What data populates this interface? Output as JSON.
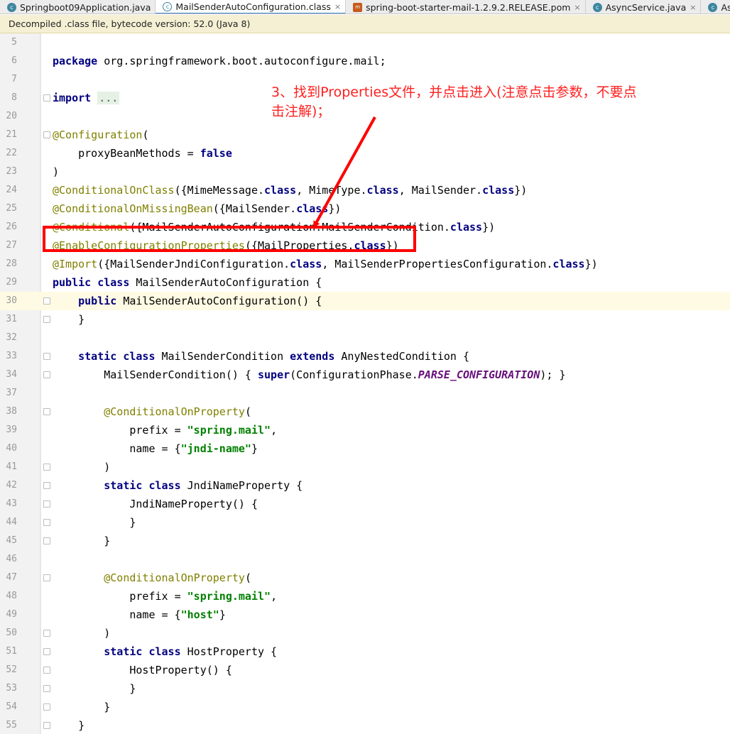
{
  "tabs": [
    {
      "label": "Springboot09Application.java",
      "icon": "java-class-icon",
      "active": false,
      "closable": false
    },
    {
      "label": "MailSenderAutoConfiguration.class",
      "icon": "class-file-icon",
      "active": true,
      "closable": true
    },
    {
      "label": "spring-boot-starter-mail-1.2.9.2.RELEASE.pom",
      "icon": "pom-file-icon",
      "active": false,
      "closable": true
    },
    {
      "label": "AsyncService.java",
      "icon": "java-class-icon",
      "active": false,
      "closable": true
    },
    {
      "label": "AsyncCom",
      "icon": "java-class-icon",
      "active": false,
      "closable": false
    }
  ],
  "banner": {
    "text": "Decompiled .class file, bytecode version: 52.0 (Java 8)"
  },
  "editor": {
    "lines": [
      {
        "num": "5",
        "code": ""
      },
      {
        "num": "6",
        "code": "package org.springframework.boot.autoconfigure.mail;"
      },
      {
        "num": "7",
        "code": ""
      },
      {
        "num": "8",
        "code": "import ...",
        "fold": true
      },
      {
        "num": "20",
        "code": ""
      },
      {
        "num": "21",
        "code": "@Configuration(",
        "fold": true
      },
      {
        "num": "22",
        "code": "    proxyBeanMethods = false"
      },
      {
        "num": "23",
        "code": ")"
      },
      {
        "num": "24",
        "code": "@ConditionalOnClass({MimeMessage.class, MimeType.class, MailSender.class})"
      },
      {
        "num": "25",
        "code": "@ConditionalOnMissingBean({MailSender.class})"
      },
      {
        "num": "26",
        "code": "@Conditional({MailSenderAutoConfiguration.MailSenderCondition.class})"
      },
      {
        "num": "27",
        "code": "@EnableConfigurationProperties({MailProperties.class})"
      },
      {
        "num": "28",
        "code": "@Import({MailSenderJndiConfiguration.class, MailSenderPropertiesConfiguration.class})"
      },
      {
        "num": "29",
        "code": "public class MailSenderAutoConfiguration {"
      },
      {
        "num": "30",
        "code": "    public MailSenderAutoConfiguration() {",
        "fold": true,
        "current": true
      },
      {
        "num": "31",
        "code": "    }",
        "fold": true
      },
      {
        "num": "32",
        "code": ""
      },
      {
        "num": "33",
        "code": "    static class MailSenderCondition extends AnyNestedCondition {",
        "fold": true
      },
      {
        "num": "34",
        "code": "        MailSenderCondition() { super(ConfigurationPhase.PARSE_CONFIGURATION); }",
        "fold": true
      },
      {
        "num": "37",
        "code": ""
      },
      {
        "num": "38",
        "code": "        @ConditionalOnProperty(",
        "fold": true
      },
      {
        "num": "39",
        "code": "            prefix = \"spring.mail\","
      },
      {
        "num": "40",
        "code": "            name = {\"jndi-name\"}"
      },
      {
        "num": "41",
        "code": "        )",
        "fold": true
      },
      {
        "num": "42",
        "code": "        static class JndiNameProperty {",
        "fold": true
      },
      {
        "num": "43",
        "code": "            JndiNameProperty() {",
        "fold": true
      },
      {
        "num": "44",
        "code": "            }",
        "fold": true
      },
      {
        "num": "45",
        "code": "        }",
        "fold": true
      },
      {
        "num": "46",
        "code": ""
      },
      {
        "num": "47",
        "code": "        @ConditionalOnProperty(",
        "fold": true
      },
      {
        "num": "48",
        "code": "            prefix = \"spring.mail\","
      },
      {
        "num": "49",
        "code": "            name = {\"host\"}"
      },
      {
        "num": "50",
        "code": "        )",
        "fold": true
      },
      {
        "num": "51",
        "code": "        static class HostProperty {",
        "fold": true
      },
      {
        "num": "52",
        "code": "            HostProperty() {",
        "fold": true
      },
      {
        "num": "53",
        "code": "            }",
        "fold": true
      },
      {
        "num": "54",
        "code": "        }",
        "fold": true
      },
      {
        "num": "55",
        "code": "    }",
        "fold": true
      }
    ]
  },
  "annotation": {
    "note": "3、找到Properties文件，并点击进入(注意点击参数，不要点击注解)；",
    "color": "#ff0000"
  },
  "colors": {
    "keyword": "#000080",
    "annotation": "#808000",
    "string": "#008000",
    "constant": "#660e7a",
    "active_tab_underline": "#4083c9",
    "banner_bg": "#f5f0d4"
  }
}
